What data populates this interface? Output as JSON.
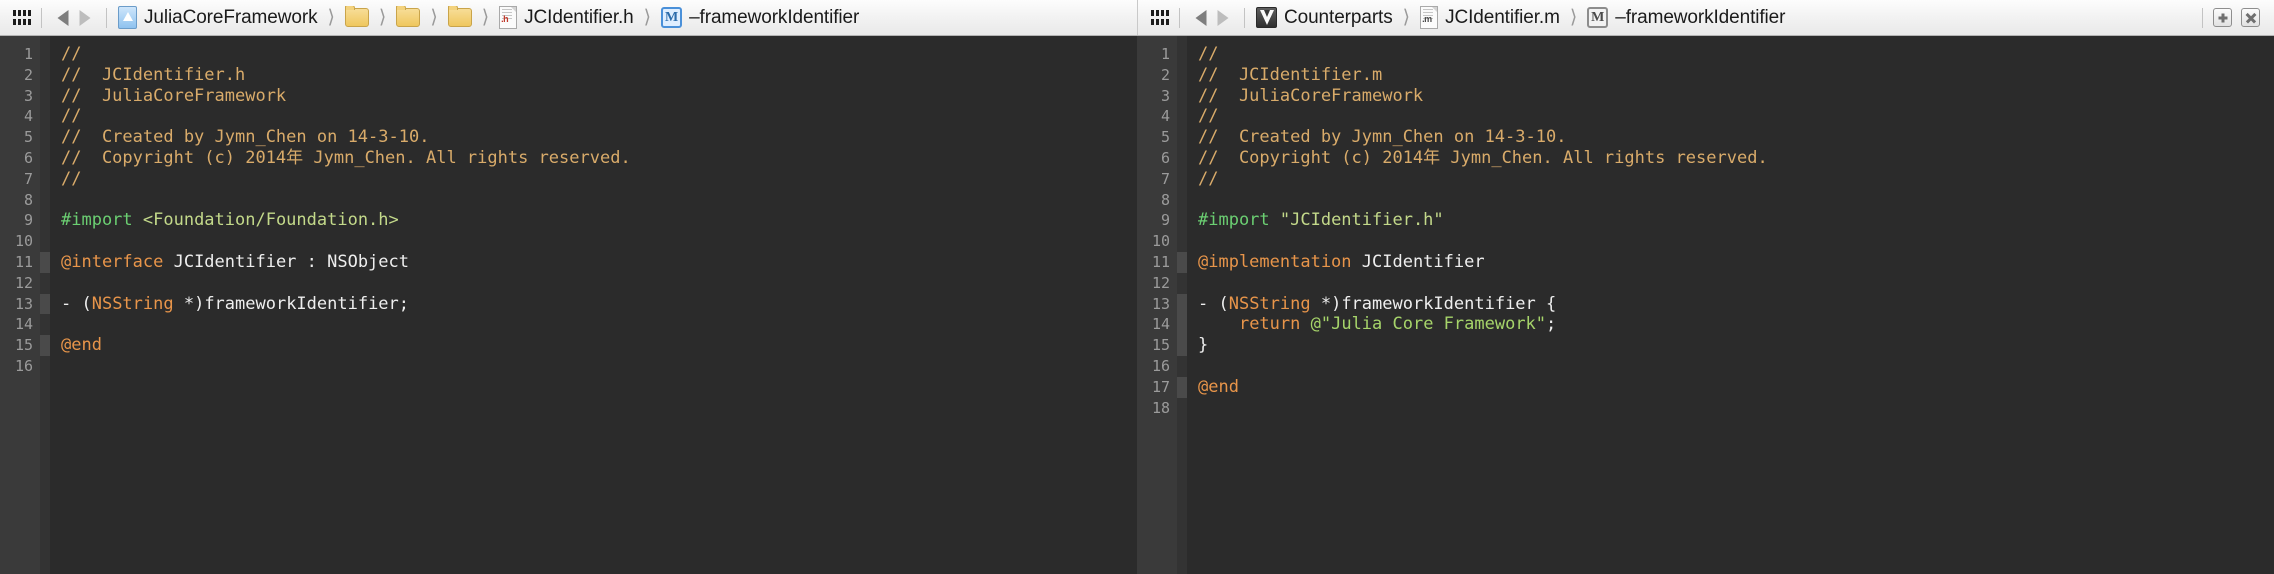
{
  "navbar": {
    "left": {
      "related_items_icon": "grid-icon",
      "back_label": "Back",
      "forward_label": "Forward",
      "breadcrumbs": [
        {
          "label": "JuliaCoreFramework",
          "icon": "project-icon"
        },
        {
          "label": "",
          "icon": "folder-icon"
        },
        {
          "label": "",
          "icon": "folder-icon"
        },
        {
          "label": "",
          "icon": "folder-icon"
        },
        {
          "label": "JCIdentifier.h",
          "icon": "header-file-icon",
          "ext": ".h"
        },
        {
          "label": "–frameworkIdentifier",
          "icon": "method-icon",
          "glyph": "M"
        }
      ]
    },
    "right": {
      "related_items_icon": "grid-icon",
      "back_label": "Back",
      "forward_label": "Forward",
      "breadcrumbs": [
        {
          "label": "Counterparts",
          "icon": "counterparts-icon"
        },
        {
          "label": "JCIdentifier.m",
          "icon": "source-file-icon",
          "ext": ".m"
        },
        {
          "label": "–frameworkIdentifier",
          "icon": "method-icon",
          "glyph": "M"
        }
      ],
      "window_buttons": [
        {
          "name": "add-editor-button",
          "icon": "plus-icon"
        },
        {
          "name": "close-editor-button",
          "icon": "close-icon"
        }
      ]
    }
  },
  "editors": [
    {
      "id": "left-editor",
      "file": "JCIdentifier.h",
      "first_line": 1,
      "line_count": 16,
      "active_fold_lines": [
        11,
        13,
        15
      ],
      "lines": [
        [
          {
            "t": "//",
            "c": "comment"
          }
        ],
        [
          {
            "t": "//  JCIdentifier.h",
            "c": "comment"
          }
        ],
        [
          {
            "t": "//  JuliaCoreFramework",
            "c": "comment"
          }
        ],
        [
          {
            "t": "//",
            "c": "comment"
          }
        ],
        [
          {
            "t": "//  Created by Jymn_Chen on 14-3-10.",
            "c": "comment"
          }
        ],
        [
          {
            "t": "//  Copyright (c) 2014年 Jymn_Chen. All rights reserved.",
            "c": "comment"
          }
        ],
        [
          {
            "t": "//",
            "c": "comment"
          }
        ],
        [],
        [
          {
            "t": "#import ",
            "c": "pre"
          },
          {
            "t": "<Foundation/Foundation.h>",
            "c": "incl"
          }
        ],
        [],
        [
          {
            "t": "@interface",
            "c": "kw"
          },
          {
            "t": " JCIdentifier : NSObject",
            "c": "plain"
          }
        ],
        [],
        [
          {
            "t": "- (",
            "c": "plain"
          },
          {
            "t": "NSString",
            "c": "type"
          },
          {
            "t": " *)frameworkIdentifier;",
            "c": "plain"
          }
        ],
        [],
        [
          {
            "t": "@end",
            "c": "kw"
          }
        ],
        []
      ]
    },
    {
      "id": "right-editor",
      "file": "JCIdentifier.m",
      "first_line": 1,
      "line_count": 18,
      "active_fold_lines": [
        11,
        13,
        14,
        15,
        17
      ],
      "lines": [
        [
          {
            "t": "//",
            "c": "comment"
          }
        ],
        [
          {
            "t": "//  JCIdentifier.m",
            "c": "comment"
          }
        ],
        [
          {
            "t": "//  JuliaCoreFramework",
            "c": "comment"
          }
        ],
        [
          {
            "t": "//",
            "c": "comment"
          }
        ],
        [
          {
            "t": "//  Created by Jymn_Chen on 14-3-10.",
            "c": "comment"
          }
        ],
        [
          {
            "t": "//  Copyright (c) 2014年 Jymn_Chen. All rights reserved.",
            "c": "comment"
          }
        ],
        [
          {
            "t": "//",
            "c": "comment"
          }
        ],
        [],
        [
          {
            "t": "#import ",
            "c": "pre"
          },
          {
            "t": "\"JCIdentifier.h\"",
            "c": "incl"
          }
        ],
        [],
        [
          {
            "t": "@implementation",
            "c": "kw"
          },
          {
            "t": " JCIdentifier",
            "c": "plain"
          }
        ],
        [],
        [
          {
            "t": "- (",
            "c": "plain"
          },
          {
            "t": "NSString",
            "c": "type"
          },
          {
            "t": " *)frameworkIdentifier {",
            "c": "plain"
          }
        ],
        [
          {
            "t": "    ",
            "c": "plain"
          },
          {
            "t": "return",
            "c": "kw"
          },
          {
            "t": " ",
            "c": "plain"
          },
          {
            "t": "@\"Julia Core Framework\"",
            "c": "str"
          },
          {
            "t": ";",
            "c": "plain"
          }
        ],
        [
          {
            "t": "}",
            "c": "plain"
          }
        ],
        [],
        [
          {
            "t": "@end",
            "c": "kw"
          }
        ],
        []
      ]
    }
  ],
  "colors": {
    "editor_background": "#2b2b2b",
    "gutter_background": "#3a3a3a",
    "line_number": "#9b9b9b",
    "comment": "#d9ab6a",
    "preprocessor": "#6bcf72",
    "include_path": "#c3d98a",
    "keyword": "#e8954a",
    "type": "#e8954a",
    "string": "#a6d46a",
    "plain_text": "#eeeeee",
    "navbar_background": "#f2f2f2"
  }
}
